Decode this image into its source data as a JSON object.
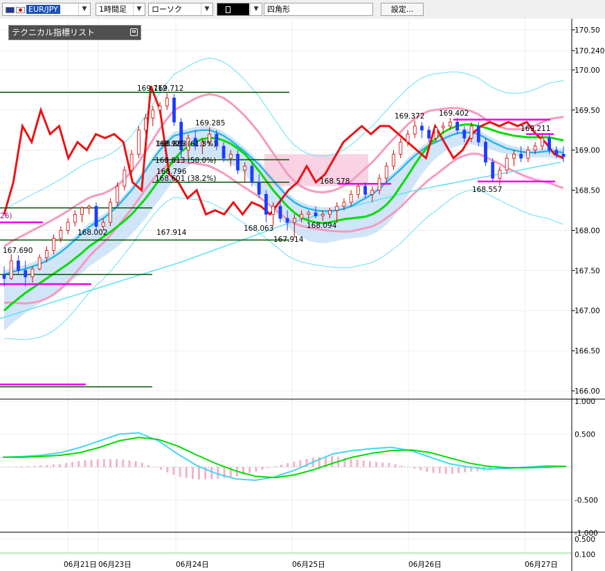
{
  "toolbar": {
    "symbol": "EUR/JPY",
    "timeframe": "1時間足",
    "chart_style": "ローソク",
    "draw_tool": "四角形",
    "settings_label": "設定..."
  },
  "tech_list": {
    "label": "テクニカル指標リスト"
  },
  "colors": {
    "up_candle": "#ffffff",
    "down_candle": "#1e3cff",
    "ma_fast": "#29b6e8",
    "ma_slow": "#00dd00",
    "bb_outer": "#7fe3f5",
    "bb_inner": "#f59ac0",
    "red_line": "#ee1111",
    "cloud": "#c0dcf5",
    "cloud_pink": "#f7c8dc",
    "hline": "#005500",
    "magenta": "#ee00ee"
  },
  "chart_data": [
    {
      "type": "candlestick",
      "ylim": [
        166.0,
        170.5
      ],
      "y_ticks": [
        "170.50",
        "170.240",
        "170.00",
        "169.50",
        "169.00",
        "168.50",
        "168.00",
        "167.50",
        "167.00",
        "166.50",
        "166.00"
      ],
      "x_labels": [
        "06月21日",
        "06月23日",
        "06月24日",
        "06月25日",
        "06月26日",
        "06月27日"
      ],
      "price_labels": [
        "169.712",
        "169.712",
        "169.285",
        "168.863",
        "168.796",
        "168.063",
        "167.914",
        "167.914",
        "168.094",
        "168.578",
        "169.372",
        "169.402",
        "169.211",
        "168.557",
        "167.690",
        "168.002"
      ],
      "fib_labels": [
        "168.925 (61.8%)",
        "168.813 (50.0%)",
        "168.601 (38.2%)"
      ],
      "partial_label": "26)",
      "candles": [
        [
          167.45,
          167.55,
          167.3,
          167.4
        ],
        [
          167.4,
          167.7,
          167.38,
          167.62
        ],
        [
          167.62,
          167.69,
          167.45,
          167.5
        ],
        [
          167.5,
          167.62,
          167.3,
          167.42
        ],
        [
          167.42,
          167.55,
          167.35,
          167.52
        ],
        [
          167.52,
          167.7,
          167.5,
          167.66
        ],
        [
          167.66,
          167.8,
          167.6,
          167.75
        ],
        [
          167.75,
          167.95,
          167.7,
          167.9
        ],
        [
          167.9,
          168.05,
          167.85,
          168.0
        ],
        [
          168.0,
          168.15,
          167.95,
          168.1
        ],
        [
          168.1,
          168.25,
          168.05,
          168.2
        ],
        [
          168.2,
          168.3,
          168.1,
          168.28
        ],
        [
          168.28,
          168.32,
          168.2,
          168.3
        ],
        [
          168.3,
          168.35,
          168.0,
          168.05
        ],
        [
          168.05,
          168.15,
          168.0,
          168.1
        ],
        [
          168.1,
          168.4,
          168.05,
          168.35
        ],
        [
          168.35,
          168.6,
          168.3,
          168.55
        ],
        [
          168.55,
          168.8,
          168.5,
          168.75
        ],
        [
          168.75,
          169.0,
          168.7,
          168.95
        ],
        [
          168.95,
          169.3,
          168.9,
          169.25
        ],
        [
          169.25,
          169.45,
          169.2,
          169.4
        ],
        [
          169.4,
          169.55,
          169.3,
          169.5
        ],
        [
          169.5,
          169.6,
          169.45,
          169.55
        ],
        [
          169.55,
          169.71,
          169.5,
          169.65
        ],
        [
          169.65,
          169.7,
          169.3,
          169.35
        ],
        [
          169.35,
          169.4,
          168.9,
          169.0
        ],
        [
          169.0,
          169.2,
          168.9,
          169.15
        ],
        [
          169.15,
          169.25,
          169.0,
          169.05
        ],
        [
          169.05,
          169.15,
          168.95,
          169.1
        ],
        [
          169.1,
          169.28,
          169.05,
          169.2
        ],
        [
          169.2,
          169.25,
          169.0,
          169.05
        ],
        [
          169.05,
          169.1,
          168.85,
          168.9
        ],
        [
          168.9,
          169.0,
          168.8,
          168.95
        ],
        [
          168.95,
          169.0,
          168.7,
          168.75
        ],
        [
          168.75,
          168.85,
          168.6,
          168.8
        ],
        [
          168.8,
          168.85,
          168.55,
          168.6
        ],
        [
          168.6,
          168.7,
          168.4,
          168.45
        ],
        [
          168.45,
          168.5,
          168.1,
          168.2
        ],
        [
          168.2,
          168.35,
          168.06,
          168.3
        ],
        [
          168.3,
          168.4,
          168.1,
          168.15
        ],
        [
          168.15,
          168.25,
          168.0,
          168.1
        ],
        [
          168.1,
          168.2,
          167.91,
          168.15
        ],
        [
          168.15,
          168.25,
          168.1,
          168.2
        ],
        [
          168.2,
          168.25,
          168.12,
          168.22
        ],
        [
          168.22,
          168.3,
          168.15,
          168.18
        ],
        [
          168.18,
          168.25,
          168.12,
          168.2
        ],
        [
          168.2,
          168.28,
          168.15,
          168.25
        ],
        [
          168.25,
          168.35,
          168.09,
          168.3
        ],
        [
          168.3,
          168.4,
          168.25,
          168.35
        ],
        [
          168.35,
          168.5,
          168.3,
          168.45
        ],
        [
          168.45,
          168.58,
          168.4,
          168.55
        ],
        [
          168.55,
          168.6,
          168.4,
          168.45
        ],
        [
          168.45,
          168.55,
          168.35,
          168.5
        ],
        [
          168.5,
          168.7,
          168.45,
          168.65
        ],
        [
          168.65,
          168.85,
          168.6,
          168.8
        ],
        [
          168.8,
          169.0,
          168.75,
          168.95
        ],
        [
          168.95,
          169.15,
          168.9,
          169.1
        ],
        [
          169.1,
          169.25,
          169.05,
          169.2
        ],
        [
          169.2,
          169.37,
          169.15,
          169.3
        ],
        [
          169.3,
          169.35,
          169.15,
          169.25
        ],
        [
          169.25,
          169.3,
          169.1,
          169.15
        ],
        [
          169.15,
          169.3,
          169.1,
          169.28
        ],
        [
          169.28,
          169.35,
          169.2,
          169.3
        ],
        [
          169.3,
          169.4,
          169.25,
          169.35
        ],
        [
          169.35,
          169.4,
          169.2,
          169.25
        ],
        [
          169.25,
          169.3,
          169.1,
          169.15
        ],
        [
          169.15,
          169.35,
          169.1,
          169.3
        ],
        [
          169.3,
          169.35,
          169.05,
          169.1
        ],
        [
          169.1,
          169.15,
          168.8,
          168.85
        ],
        [
          168.85,
          168.9,
          168.6,
          168.65
        ],
        [
          168.65,
          168.8,
          168.56,
          168.75
        ],
        [
          168.75,
          168.95,
          168.7,
          168.9
        ],
        [
          168.9,
          169.0,
          168.8,
          168.95
        ],
        [
          168.95,
          169.05,
          168.85,
          168.9
        ],
        [
          168.9,
          169.05,
          168.85,
          169.0
        ],
        [
          169.0,
          169.1,
          168.95,
          169.05
        ],
        [
          169.05,
          169.21,
          169.0,
          169.15
        ],
        [
          169.15,
          169.2,
          168.95,
          169.0
        ],
        [
          169.0,
          169.05,
          168.9,
          168.95
        ],
        [
          168.95,
          169.05,
          168.85,
          168.92
        ]
      ],
      "series": [
        {
          "name": "",
          "role": "ma_fast",
          "values": [
            167.45,
            167.48,
            167.5,
            167.52,
            167.55,
            167.58,
            167.62,
            167.67,
            167.73,
            167.8,
            167.88,
            167.96,
            168.04,
            168.1,
            168.15,
            168.22,
            168.3,
            168.4,
            168.5,
            168.62,
            168.75,
            168.88,
            169.0,
            169.1,
            169.18,
            169.2,
            169.22,
            169.24,
            169.25,
            169.25,
            169.22,
            169.18,
            169.12,
            169.05,
            168.98,
            168.9,
            168.82,
            168.72,
            168.62,
            168.52,
            168.42,
            168.35,
            168.3,
            168.27,
            168.25,
            168.24,
            168.24,
            168.25,
            168.27,
            168.3,
            168.35,
            168.4,
            168.45,
            168.52,
            168.6,
            168.68,
            168.76,
            168.85,
            168.93,
            169.0,
            169.06,
            169.1,
            169.14,
            169.18,
            169.21,
            169.22,
            169.22,
            169.2,
            169.15,
            169.1,
            169.06,
            169.02,
            169.0,
            168.98,
            168.97,
            168.97,
            168.98,
            168.99,
            168.98,
            168.97
          ]
        },
        {
          "name": "",
          "role": "ma_slow",
          "values": [
            167.0,
            167.08,
            167.15,
            167.22,
            167.28,
            167.34,
            167.4,
            167.46,
            167.52,
            167.58,
            167.65,
            167.72,
            167.8,
            167.86,
            167.92,
            167.98,
            168.05,
            168.12,
            168.2,
            168.3,
            168.4,
            168.52,
            168.64,
            168.76,
            168.88,
            168.98,
            169.05,
            169.1,
            169.14,
            169.15,
            169.15,
            169.12,
            169.08,
            169.02,
            168.95,
            168.85,
            168.74,
            168.62,
            168.5,
            168.4,
            168.3,
            168.22,
            168.16,
            168.12,
            168.1,
            168.09,
            168.1,
            168.12,
            168.14,
            168.15,
            168.16,
            168.17,
            168.2,
            168.25,
            168.32,
            168.42,
            168.55,
            168.68,
            168.82,
            168.95,
            169.06,
            169.15,
            169.22,
            169.27,
            169.3,
            169.32,
            169.32,
            169.3,
            169.28,
            169.25,
            169.22,
            169.2,
            169.18,
            169.17,
            169.16,
            169.16,
            169.16,
            169.16,
            169.14,
            169.12
          ]
        },
        {
          "name": "",
          "role": "red_line",
          "values": [
            168.2,
            168.6,
            169.3,
            169.1,
            169.5,
            169.2,
            169.3,
            168.9,
            169.1,
            169.0,
            169.2,
            169.15,
            169.2,
            169.1,
            168.6,
            168.5,
            169.8,
            169.5,
            168.7,
            168.6,
            168.4,
            168.5,
            168.2,
            168.25,
            168.2,
            168.35,
            168.2,
            168.35,
            168.3,
            168.2,
            168.35,
            168.5,
            168.6,
            168.8,
            168.6,
            168.7,
            168.9,
            169.1,
            169.2,
            169.3,
            169.2,
            169.3,
            169.3,
            169.2,
            169.1,
            169.0,
            168.9,
            169.3,
            169.1,
            168.9,
            169.0,
            169.2,
            169.3,
            169.35,
            169.3,
            169.35,
            169.3,
            169.35,
            169.2,
            169.1,
            168.95,
            168.9
          ]
        }
      ]
    },
    {
      "type": "line",
      "ylim": [
        -1.0,
        1.0
      ],
      "y_ticks": [
        "1.000",
        "0.500",
        "-0.500",
        "-1.000"
      ],
      "series": [
        {
          "name": "",
          "role": "macd",
          "values": [
            0.15,
            0.16,
            0.18,
            0.22,
            0.3,
            0.4,
            0.5,
            0.52,
            0.4,
            0.2,
            0.02,
            -0.1,
            -0.18,
            -0.2,
            -0.15,
            -0.05,
            0.08,
            0.2,
            0.25,
            0.28,
            0.3,
            0.25,
            0.15,
            0.05,
            0.0,
            -0.03,
            -0.02,
            0.0,
            0.02,
            0.01
          ]
        },
        {
          "name": "",
          "role": "signal",
          "values": [
            0.15,
            0.15,
            0.16,
            0.18,
            0.22,
            0.3,
            0.4,
            0.45,
            0.42,
            0.32,
            0.18,
            0.05,
            -0.06,
            -0.14,
            -0.16,
            -0.12,
            -0.04,
            0.06,
            0.15,
            0.21,
            0.25,
            0.26,
            0.22,
            0.14,
            0.06,
            0.01,
            -0.01,
            -0.01,
            0.0,
            0.01
          ]
        }
      ]
    },
    {
      "type": "line",
      "y_ticks": [
        "0.500",
        "0.100"
      ]
    }
  ]
}
